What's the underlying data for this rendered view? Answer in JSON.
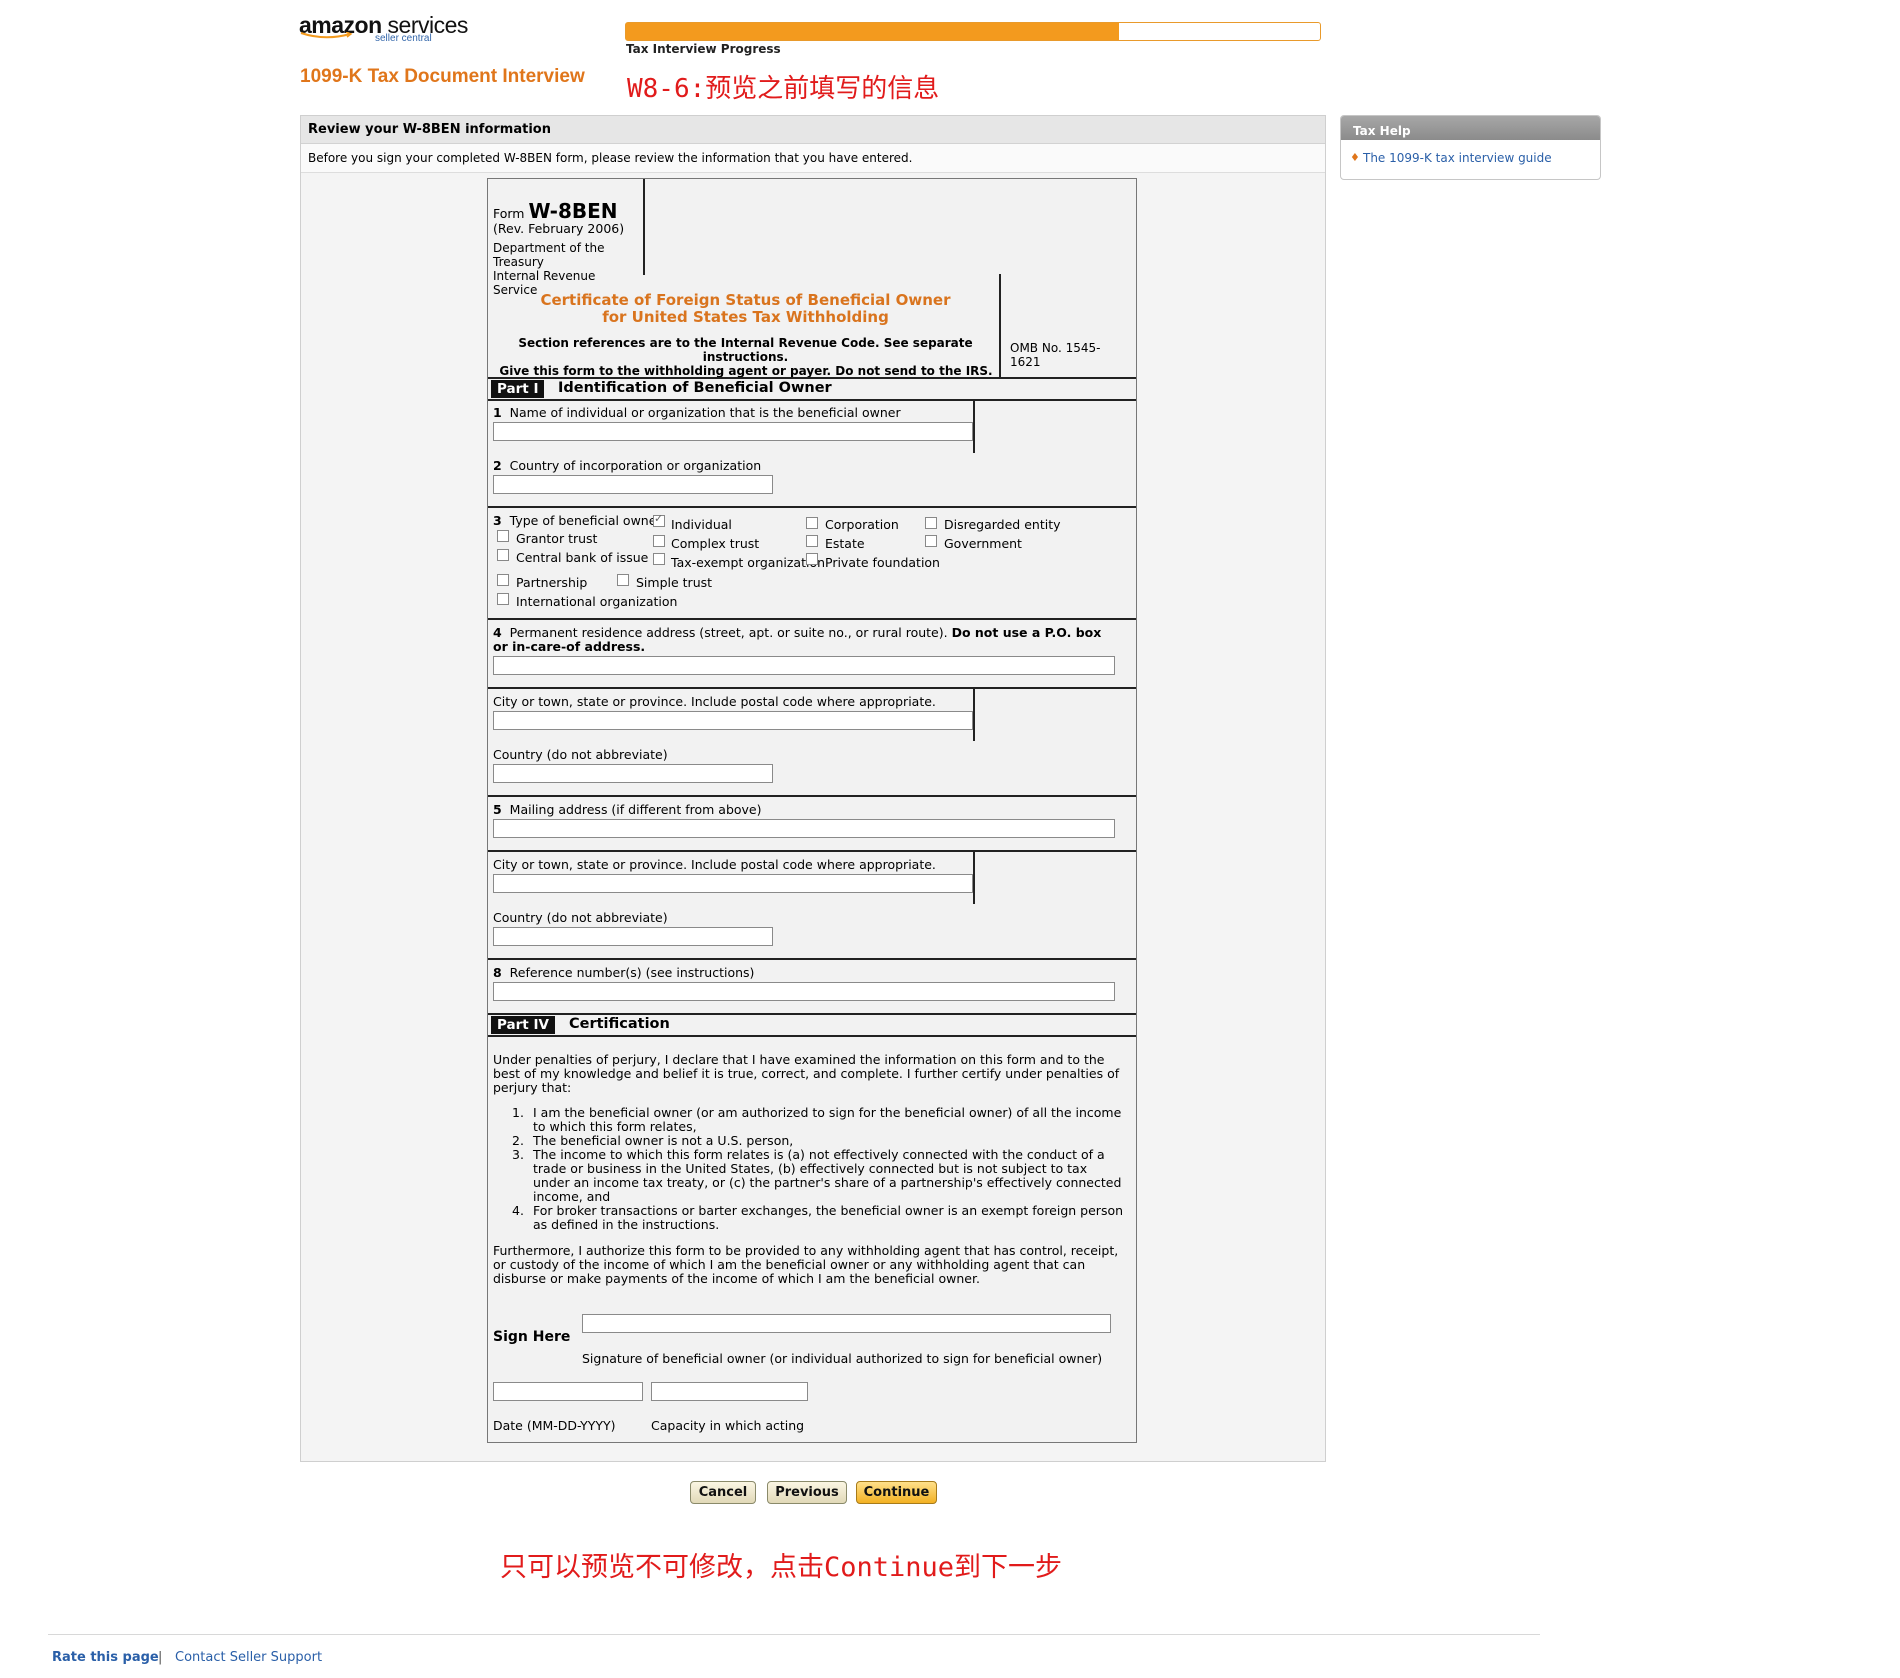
{
  "header": {
    "logo_brand": "amazon",
    "logo_services": "services",
    "logo_sub": "seller central",
    "page_title": "1099-K Tax Document Interview",
    "annotation_top": "W8-6:预览之前填写的信息",
    "progress_percent": 71,
    "progress_label": "71%",
    "progress_caption": "Tax Interview Progress"
  },
  "panel": {
    "heading": "Review your W-8BEN information",
    "intro": "Before you sign your completed W-8BEN form, please review the information that you have entered."
  },
  "help": {
    "heading": "Tax Help",
    "link": "The 1099-K tax interview guide"
  },
  "form": {
    "form_word": "Form",
    "form_name": "W-8BEN",
    "revision": "(Rev. February 2006)",
    "dept_lines": [
      "Department of the",
      "Treasury",
      "Internal Revenue",
      "Service"
    ],
    "title_line1": "Certificate of Foreign Status of Beneficial Owner",
    "title_line2": "for United States Tax Withholding",
    "section_refs_1": "Section references are to the Internal Revenue Code. See separate",
    "section_refs_2": "instructions.",
    "give_form": "Give this form to the withholding agent or payer. Do not send to the IRS.",
    "omb_1": "OMB No. 1545-",
    "omb_2": "1621",
    "part1_label": "Part I",
    "part1_title": "Identification of Beneficial Owner",
    "f1_num": "1",
    "f1_label": "Name of individual or organization that is the beneficial owner",
    "f2_num": "2",
    "f2_label": "Country of incorporation or organization",
    "f3_num": "3",
    "f3_label": "Type of beneficial owner:",
    "types": {
      "individual": "Individual",
      "corporation": "Corporation",
      "disregarded": "Disregarded entity",
      "grantor": "Grantor trust",
      "complex": "Complex trust",
      "estate": "Estate",
      "government": "Government",
      "central_bank": "Central bank of issue",
      "tax_exempt": "Tax-exempt organization",
      "private_foundation": "Private foundation",
      "partnership": "Partnership",
      "simple": "Simple trust",
      "international": "International organization"
    },
    "f4_num": "4",
    "f4_label": "Permanent residence address (street, apt. or suite no., or rural route).",
    "f4_bold": "Do not use a P.O. box",
    "f4_bold2": "or in-care-of address.",
    "city_label": "City or town, state or province. Include postal code where appropriate.",
    "country_label": "Country (do not abbreviate)",
    "f5_num": "5",
    "f5_label": "Mailing address (if different from above)",
    "city2_label": "City or town, state or province. Include postal code where appropriate.",
    "country2_label": "Country (do not abbreviate)",
    "f8_num": "8",
    "f8_label": "Reference number(s) (see instructions)",
    "part4_label": "Part IV",
    "part4_title": "Certification",
    "cert_intro_1": "Under penalties of perjury, I declare that I have examined the information on this form and to the",
    "cert_intro_2": "best of my knowledge and belief it is true, correct, and complete. I further certify under penalties of",
    "cert_intro_3": "perjury that:",
    "cert_items": [
      [
        "1.",
        "I am the beneficial owner (or am authorized to sign for the beneficial owner) of all the income",
        "to which this form relates,"
      ],
      [
        "2.",
        "The beneficial owner is not a U.S. person,"
      ],
      [
        "3.",
        "The income to which this form relates is (a) not effectively connected with the conduct of a",
        "trade or business in the United States, (b) effectively connected but is not subject to tax",
        "under an income tax treaty, or (c) the partner's share of a partnership's effectively connected",
        "income, and"
      ],
      [
        "4.",
        "For broker transactions or barter exchanges, the beneficial owner is an exempt foreign person",
        "as defined in the instructions."
      ]
    ],
    "further_1": "Furthermore, I authorize this form to be provided to any withholding agent that has control, receipt,",
    "further_2": "or custody of the income of which I am the beneficial owner or any withholding agent that can",
    "further_3": "disburse or make payments of the income of which I am the beneficial owner.",
    "sign_here": "Sign Here",
    "sig_caption": "Signature of beneficial owner (or individual authorized to sign for beneficial owner)",
    "date_caption": "Date (MM-DD-YYYY)",
    "capacity_caption": "Capacity in which acting"
  },
  "buttons": {
    "cancel": "Cancel",
    "previous": "Previous",
    "continue": "Continue"
  },
  "annotation_bottom": "只可以预览不可修改，点击Continue到下一步",
  "footer": {
    "rate": "Rate this page",
    "separator": "|",
    "contact": "Contact Seller Support"
  }
}
